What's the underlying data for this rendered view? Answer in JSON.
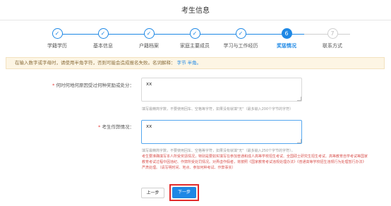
{
  "page_title": "考生信息",
  "steps": [
    {
      "label": "学籍学历",
      "state": "done",
      "marker": "✓"
    },
    {
      "label": "基本信息",
      "state": "done",
      "marker": "✓"
    },
    {
      "label": "户籍档案",
      "state": "done",
      "marker": "✓"
    },
    {
      "label": "家庭主要成员",
      "state": "done",
      "marker": "✓"
    },
    {
      "label": "学习与工作经历",
      "state": "done",
      "marker": "✓"
    },
    {
      "label": "奖惩情况",
      "state": "active",
      "marker": "6"
    },
    {
      "label": "联系方式",
      "state": "todo",
      "marker": "7"
    }
  ],
  "notice": {
    "text": "在输入数字或字母时，请使用半角字符，否则可能会造成报名失败。名词解释：",
    "link_fullwidth": "字节",
    "link_halfwidth": "半角。"
  },
  "reward": {
    "label": "何时何地何原因受过何种奖励或处分：",
    "value": "xx",
    "hint": "填写最精简字数，不要使用回车、空格等字符，如果没有就填\"无\"（最多输入200个字节的字符）"
  },
  "cheating": {
    "label": "考生作弊情况：",
    "value": "xx",
    "hint": "填写最精简字数，不要使用回车、空格等字符，如果没有就填\"无\"（最多输入250个字节的字符）。",
    "warning": "考生要准确填写本人所受奖惩情况，特别是要如实填写在参加普通和成人高等学校招生考试、全国硕士研究生招生考试、高等教育自学考试等国家教育考试过程中因违纪、作弊所受处罚情况。对弄虚作假者，将按照《国家教育考试违规处理办法》《普通高等学校招生违规行为处理暂行办法》严肃处理。（请写明时间、地点、参加何种考试、作弊事实）"
  },
  "buttons": {
    "prev": "上一步",
    "next": "下一步"
  },
  "colors": {
    "accent": "#1e88e5",
    "highlight_box": "#e32b2b",
    "notice_bg": "#fdf5e4"
  }
}
